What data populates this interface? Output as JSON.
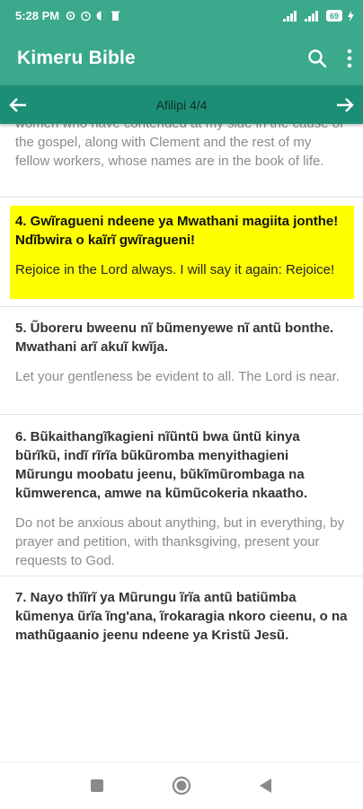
{
  "status_bar": {
    "time": "5:28 PM",
    "battery": "69",
    "colors": {
      "bar": "#3aa98c"
    }
  },
  "app_bar": {
    "title": "Kimeru Bible",
    "search_icon": "search-icon",
    "menu_icon": "more-vert-icon"
  },
  "chapter_nav": {
    "title": "Afilipi 4/4",
    "prev_icon": "arrow-left-icon",
    "next_icon": "arrow-right-icon"
  },
  "verses": [
    {
      "title": "",
      "translation": "women who have contended at my side in the cause of the gospel, along with Clement and the rest of my fellow workers, whose names are in the book of life."
    },
    {
      "title": "4. Gwĩragueni ndeene ya Mwathani magiita jonthe! Ndĩbwira o kaĩrĩ gwĩragueni!",
      "translation": "Rejoice in the Lord always. I will say it again: Rejoice!",
      "highlighted": true
    },
    {
      "title": "5. Ũboreru bweenu nĩ bũmenyewe nĩ antũ bonthe. Mwathani arĩ akuĩ kwĩja.",
      "translation": "Let your gentleness be evident to all. The Lord is near."
    },
    {
      "title": "6. Bũkaithangĩkagieni nĩũntũ bwa ũntũ kinya bũrĩkũ, indĩ rĩrĩa bũkũromba menyithagieni Mũrungu moobatu jeenu, bũkĩmũrombaga na kũmwerenca, amwe na kũmũcokeria nkaatho.",
      "translation": "Do not be anxious about anything, but in everything, by prayer and petition, with thanksgiving, present your requests to God."
    },
    {
      "title": "7. Nayo thĩĩrĩ ya Mũrungu ĩrĩa antũ batiũmba kũmenya ũrĩa ĩng'ana, ĩrokaragia nkoro cieenu, o na mathũgaanio jeenu ndeene ya Kristũ Jesũ.",
      "translation": ""
    }
  ],
  "highlight_color": "#ffff00",
  "bottom_nav": {
    "items": [
      "recents-icon",
      "home-icon",
      "back-icon"
    ]
  }
}
